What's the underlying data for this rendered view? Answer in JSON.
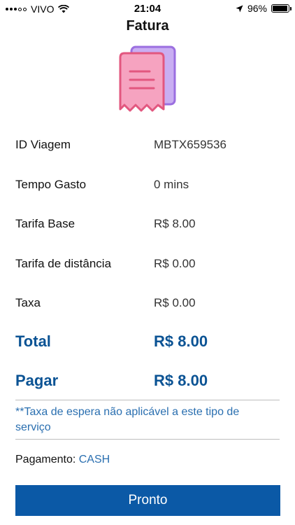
{
  "status_bar": {
    "carrier": "VIVO",
    "time": "21:04",
    "battery": "96%",
    "battery_level": 0.96
  },
  "header": {
    "title": "Fatura"
  },
  "icon": {
    "name": "invoice-receipt-icon",
    "colors": {
      "front": "#f48fb1",
      "front_stroke": "#e2577f",
      "back": "#c5a8f0",
      "back_stroke": "#9b6fe0"
    }
  },
  "details": [
    {
      "label": "ID Viagem",
      "value": "MBTX659536"
    },
    {
      "label": "Tempo Gasto",
      "value": "0 mins"
    },
    {
      "label": "Tarifa Base",
      "value": "R$ 8.00"
    },
    {
      "label": "Tarifa de distância",
      "value": "R$ 0.00"
    },
    {
      "label": "Taxa",
      "value": "R$ 0.00"
    }
  ],
  "totals": [
    {
      "label": "Total",
      "value": "R$ 8.00"
    },
    {
      "label": "Pagar",
      "value": "R$ 8.00"
    }
  ],
  "note": "**Taxa de espera não aplicável a este tipo de serviço",
  "payment": {
    "label": "Pagamento:",
    "method": "CASH"
  },
  "button": {
    "label": "Pronto"
  },
  "colors": {
    "accent": "#0b59a6",
    "total_text": "#0b5394",
    "link_text": "#2a6fb0"
  }
}
